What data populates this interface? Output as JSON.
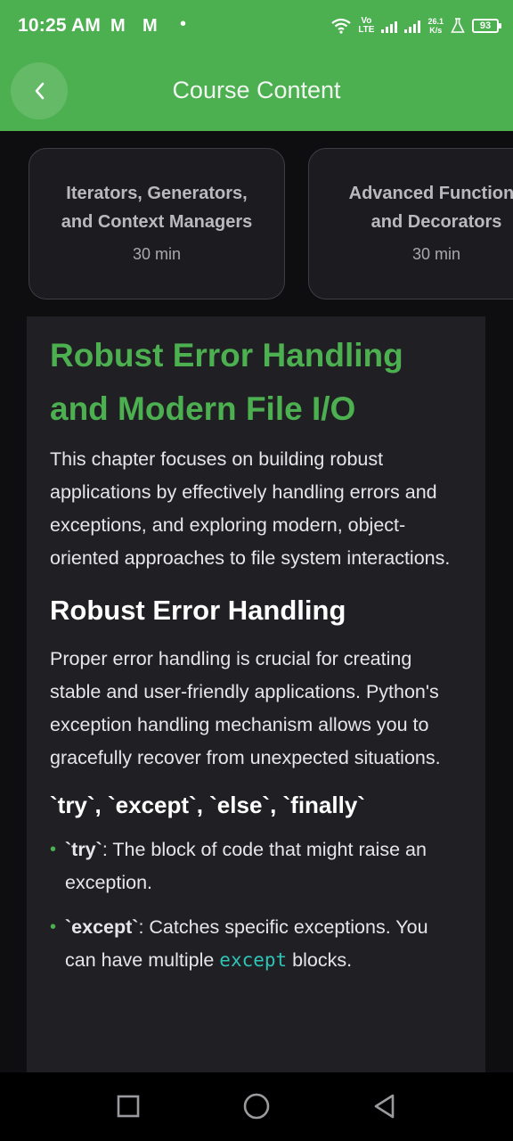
{
  "status_bar": {
    "time": "10:25 AM",
    "mail_icon_1": "M",
    "mail_icon_2": "M",
    "dot": "•",
    "volte_top": "Vo",
    "volte_bottom": "LTE",
    "speed_value": "26.1",
    "speed_unit": "K/s",
    "battery": "93"
  },
  "app_bar": {
    "back_icon": "chevron-left-icon",
    "title": "Course Content"
  },
  "lessons": [
    {
      "title_line1": "Iterators, Generators,",
      "title_line2": "and Context Managers",
      "duration": "30 min"
    },
    {
      "title_line1": "Advanced Functions",
      "title_line2": "and Decorators",
      "duration": "30 min"
    }
  ],
  "content": {
    "title_line1": "Robust Error Handling",
    "title_line2": "and Modern File I/O",
    "intro": "This chapter focuses on building robust applications by effectively handling errors and exceptions, and exploring modern, object-oriented approaches to file system interactions.",
    "section_heading": "Robust Error Handling",
    "section_text": "Proper error handling is crucial for creating stable and user-friendly applications. Python's exception handling mechanism allows you to gracefully recover from unexpected situations.",
    "subheading": "`try`, `except`, `else`, `finally`",
    "bullets": [
      {
        "kw": "`try`",
        "text": ": The block of code that might raise an exception."
      },
      {
        "kw": "`except`",
        "text": ": Catches specific exceptions. You can have multiple ",
        "code": "except",
        "tail": " blocks."
      }
    ]
  },
  "nav_bar": {
    "recents_icon": "square-icon",
    "home_icon": "circle-icon",
    "back_icon": "triangle-back-icon"
  },
  "colors": {
    "accent": "#4caf50",
    "background": "#0e0e10",
    "panel": "#202024",
    "code": "#2ec4b6"
  }
}
